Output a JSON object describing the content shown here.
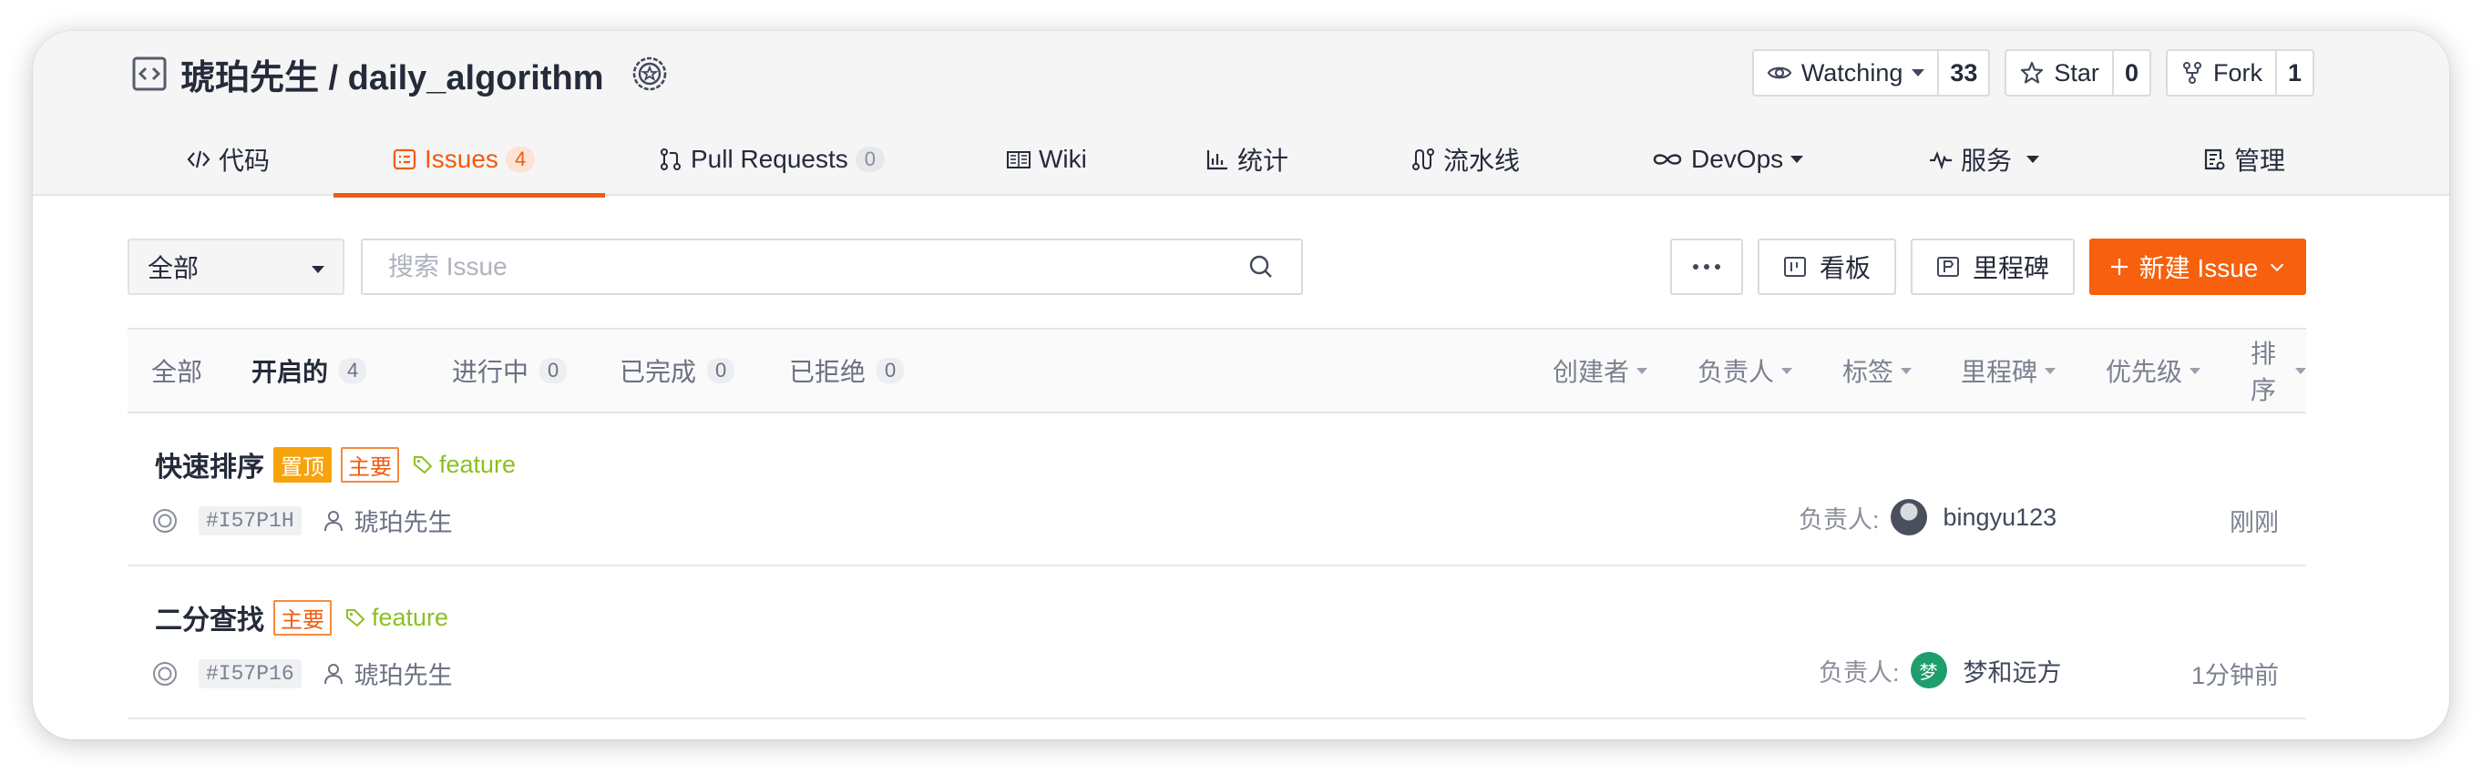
{
  "repo": {
    "title": "琥珀先生 / daily_algorithm",
    "watch_label": "Watching",
    "watch_count": "33",
    "star_label": "Star",
    "star_count": "0",
    "fork_label": "Fork",
    "fork_count": "1"
  },
  "tabs": [
    {
      "label": "代码",
      "icon": "code-icon"
    },
    {
      "label": "Issues",
      "count": "4",
      "icon": "issue-icon"
    },
    {
      "label": "Pull Requests",
      "count": "0",
      "icon": "pull-request-icon"
    },
    {
      "label": "Wiki",
      "icon": "book-icon"
    },
    {
      "label": "统计",
      "icon": "bar-chart-icon"
    },
    {
      "label": "流水线",
      "icon": "pipeline-icon"
    },
    {
      "label": "DevOps",
      "icon": "infinity-icon"
    },
    {
      "label": "服务",
      "icon": "pulse-icon"
    },
    {
      "label": "管理",
      "icon": "settings-doc-icon"
    }
  ],
  "toolbar": {
    "scope_select": "全部",
    "search_placeholder": "搜索 Issue",
    "more_label": "···",
    "board_label": "看板",
    "milestone_label": "里程碑",
    "new_issue_label": "新建 Issue"
  },
  "states": [
    {
      "label": "全部"
    },
    {
      "label": "开启的",
      "count": "4"
    },
    {
      "label": "进行中",
      "count": "0"
    },
    {
      "label": "已完成",
      "count": "0"
    },
    {
      "label": "已拒绝",
      "count": "0"
    }
  ],
  "sort_filters": [
    "创建者",
    "负责人",
    "标签",
    "里程碑",
    "优先级",
    "排序"
  ],
  "issues": [
    {
      "title": "快速排序",
      "pinned_tag": "置顶",
      "priority_tag": "主要",
      "label": "feature",
      "number": "#I57P1H",
      "author": "琥珀先生",
      "assignee_label": "负责人:",
      "assignee": "bingyu123",
      "time": "刚刚"
    },
    {
      "title": "二分查找",
      "priority_tag": "主要",
      "label": "feature",
      "number": "#I57P16",
      "author": "琥珀先生",
      "assignee_label": "负责人:",
      "assignee": "梦和远方",
      "assignee_avatar_text": "梦",
      "time": "1分钟前"
    }
  ],
  "colors": {
    "accent": "#f05b11",
    "new_button": "#f6600e",
    "pinned": "#f7a30c",
    "feature": "#8cc01f"
  }
}
